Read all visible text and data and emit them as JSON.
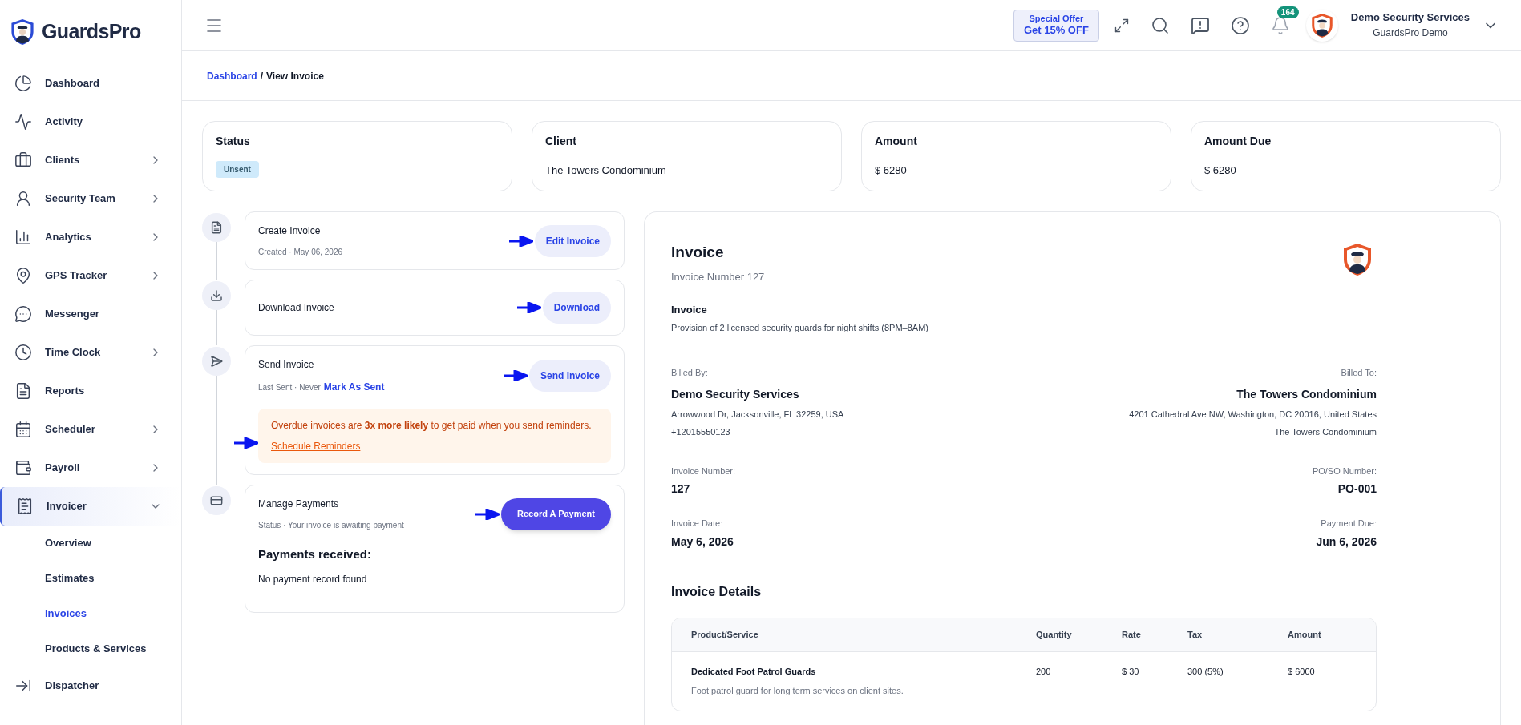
{
  "brand": {
    "name": "GuardsPro"
  },
  "sidebar": {
    "items": [
      {
        "label": "Dashboard",
        "selected": false
      },
      {
        "label": "Activity",
        "selected": false
      },
      {
        "label": "Clients",
        "expanded": false,
        "selected": false
      },
      {
        "label": "Security Team",
        "expanded": false,
        "selected": false
      },
      {
        "label": "Analytics",
        "expanded": false,
        "selected": false
      },
      {
        "label": "GPS Tracker",
        "expanded": false,
        "selected": false
      },
      {
        "label": "Messenger",
        "selected": false
      },
      {
        "label": "Time Clock",
        "expanded": false,
        "selected": false
      },
      {
        "label": "Reports",
        "selected": false
      },
      {
        "label": "Scheduler",
        "expanded": false,
        "selected": false
      },
      {
        "label": "Payroll",
        "expanded": false,
        "selected": false
      },
      {
        "label": "Invoicer",
        "expanded": true,
        "selected": true,
        "children": [
          {
            "label": "Overview",
            "selected": false
          },
          {
            "label": "Estimates",
            "selected": false
          },
          {
            "label": "Invoices",
            "selected": true
          },
          {
            "label": "Products & Services",
            "selected": false
          }
        ]
      },
      {
        "label": "Dispatcher",
        "selected": false
      }
    ]
  },
  "topbar": {
    "offer": {
      "line1": "Special Offer",
      "line2": "Get 15% OFF"
    },
    "notifications": "164",
    "user": {
      "name": "Demo Security Services",
      "company": "GuardsPro Demo"
    }
  },
  "breadcrumb": {
    "parent": "Dashboard",
    "separator": "/",
    "current": "View Invoice"
  },
  "stats": [
    {
      "label": "Status",
      "kind": "badge",
      "value": "Unsent"
    },
    {
      "label": "Client",
      "kind": "text",
      "value": "The Towers Condominium"
    },
    {
      "label": "Amount",
      "kind": "text",
      "value": "$ 6280"
    },
    {
      "label": "Amount Due",
      "kind": "text",
      "value": "$ 6280"
    }
  ],
  "steps": [
    {
      "title": "Create Invoice",
      "subtitle": "Created · May 06, 2026",
      "button": {
        "label": "Edit Invoice",
        "kind": "soft"
      }
    },
    {
      "title": "Download Invoice",
      "button": {
        "label": "Download",
        "kind": "soft"
      }
    },
    {
      "title": "Send Invoice",
      "subtitle": "Last Sent · Never",
      "link": "Mark As Sent",
      "button": {
        "label": "Send Invoice",
        "kind": "soft"
      },
      "notice": {
        "text": "Overdue invoices are **3x more likely** to get paid when you send reminders.",
        "link": "Schedule Reminders"
      }
    },
    {
      "title": "Manage Payments",
      "subtitle": "Status · Your invoice is awaiting payment",
      "button": {
        "label": "Record A Payment",
        "kind": "primary"
      },
      "payments": {
        "heading": "Payments received:",
        "empty": "No payment record found"
      }
    }
  ],
  "invoice": {
    "title": "Invoice",
    "number_line": "Invoice Number 127",
    "subject": "Invoice",
    "description": "Provision of 2 licensed security guards for night shifts (8PM–8AM)",
    "billed_by": {
      "label": "Billed By:",
      "name": "Demo Security Services",
      "lines": [
        "Arrowwood Dr, Jacksonville, FL 32259, USA",
        "+12015550123"
      ]
    },
    "billed_to": {
      "label": "Billed To:",
      "name": "The Towers Condominium",
      "lines": [
        "4201 Cathedral Ave NW, Washington, DC 20016, United States",
        "The Towers Condominium"
      ]
    },
    "fields": [
      {
        "label": "Invoice Number:",
        "value": "127"
      },
      {
        "label": "PO/SO Number:",
        "value": "PO-001"
      },
      {
        "label": "Invoice Date:",
        "value": "May 6, 2026"
      },
      {
        "label": "Payment Due:",
        "value": "Jun 6, 2026"
      }
    ],
    "details_heading": "Invoice Details",
    "table": {
      "columns": [
        "Product/Service",
        "Quantity",
        "Rate",
        "Tax",
        "Amount"
      ],
      "rows": [
        {
          "name": "Dedicated Foot Patrol Guards",
          "description": "Foot patrol guard for long term services on client sites.",
          "quantity": "200",
          "rate": "$ 30",
          "tax": "300 (5%)",
          "amount": "$ 6000"
        }
      ]
    }
  }
}
